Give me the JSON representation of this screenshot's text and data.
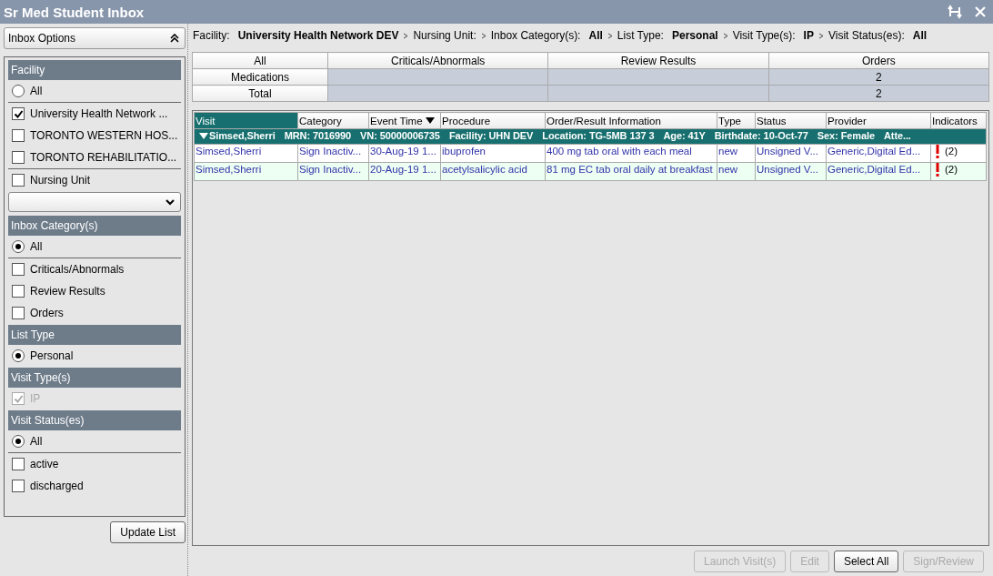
{
  "window": {
    "title": "Sr Med Student Inbox"
  },
  "sidebar": {
    "header": "Inbox Options",
    "sections": [
      {
        "title": "Facility",
        "items": [
          {
            "kind": "radio",
            "label": "All",
            "selected": false,
            "separated": true
          },
          {
            "kind": "checkbox",
            "label": "University Health Network ...",
            "checked": true,
            "disabled": false,
            "separated": false
          },
          {
            "kind": "checkbox",
            "label": "TORONTO WESTERN HOS...",
            "checked": false,
            "disabled": false,
            "separated": false
          },
          {
            "kind": "checkbox",
            "label": "TORONTO REHABILITATIO...",
            "checked": false,
            "disabled": false,
            "separated": true
          },
          {
            "kind": "checkbox",
            "label": "Nursing Unit",
            "checked": false,
            "disabled": false,
            "separated": false
          },
          {
            "kind": "select"
          }
        ]
      },
      {
        "title": "Inbox Category(s)",
        "items": [
          {
            "kind": "radio",
            "label": "All",
            "selected": true,
            "separated": true
          },
          {
            "kind": "checkbox",
            "label": "Criticals/Abnormals",
            "checked": false,
            "disabled": false,
            "separated": false
          },
          {
            "kind": "checkbox",
            "label": "Review Results",
            "checked": false,
            "disabled": false,
            "separated": false
          },
          {
            "kind": "checkbox",
            "label": "Orders",
            "checked": false,
            "disabled": false,
            "separated": false
          }
        ]
      },
      {
        "title": "List Type",
        "items": [
          {
            "kind": "radio",
            "label": "Personal",
            "selected": true,
            "separated": false
          }
        ]
      },
      {
        "title": "Visit Type(s)",
        "items": [
          {
            "kind": "checkbox",
            "label": "IP",
            "checked": true,
            "disabled": true,
            "separated": false
          }
        ]
      },
      {
        "title": "Visit Status(es)",
        "items": [
          {
            "kind": "radio",
            "label": "All",
            "selected": true,
            "separated": true
          },
          {
            "kind": "checkbox",
            "label": "active",
            "checked": false,
            "disabled": false,
            "separated": false
          },
          {
            "kind": "checkbox",
            "label": "discharged",
            "checked": false,
            "disabled": false,
            "separated": false
          }
        ]
      }
    ],
    "update_button": "Update List"
  },
  "breadcrumb": [
    {
      "label": "Facility:",
      "value": "University Health Network DEV"
    },
    {
      "label": "Nursing Unit:"
    },
    {
      "label": "Inbox Category(s):",
      "value": "All"
    },
    {
      "label": "List Type:",
      "value": "Personal"
    },
    {
      "label": "Visit Type(s):",
      "value": "IP"
    },
    {
      "label": "Visit Status(es):",
      "value": "All"
    }
  ],
  "summary": {
    "columns": [
      "All",
      "Criticals/Abnormals",
      "Review Results",
      "Orders"
    ],
    "rows": [
      {
        "label": "Medications",
        "cells": [
          "",
          "",
          "2"
        ]
      },
      {
        "label": "Total",
        "cells": [
          "",
          "",
          "2"
        ]
      }
    ]
  },
  "grid": {
    "columns": [
      {
        "label": "Visit",
        "selected": true,
        "sorted": false
      },
      {
        "label": "Category",
        "selected": false,
        "sorted": false
      },
      {
        "label": "Event Time",
        "selected": false,
        "sorted": true
      },
      {
        "label": "Procedure",
        "selected": false,
        "sorted": false
      },
      {
        "label": "Order/Result Information",
        "selected": false,
        "sorted": false
      },
      {
        "label": "Type",
        "selected": false,
        "sorted": false
      },
      {
        "label": "Status",
        "selected": false,
        "sorted": false
      },
      {
        "label": "Provider",
        "selected": false,
        "sorted": false
      },
      {
        "label": "Indicators",
        "selected": false,
        "sorted": false
      }
    ],
    "group": {
      "name": "Simsed,Sherri",
      "expanded": true,
      "details": [
        "MRN: 7016990",
        "VN: 50000006735",
        "Facility: UHN DEV",
        "Location: TG-5MB 137 3",
        "Age: 41Y",
        "Birthdate: 10-Oct-77",
        "Sex: Female",
        "Atte..."
      ]
    },
    "rows": [
      {
        "cells": [
          "Simsed,Sherri",
          "Sign Inactiv...",
          "30-Aug-19 1...",
          "ibuprofen",
          "400 mg tab oral with each meal",
          "new",
          "Unsigned V...",
          "Generic,Digital Ed..."
        ],
        "alert": true,
        "indicator": "(2)"
      },
      {
        "cells": [
          "Simsed,Sherri",
          "Sign Inactiv...",
          "20-Aug-19 1...",
          "acetylsalicylic acid",
          "81 mg EC tab oral daily at breakfast",
          "new",
          "Unsigned V...",
          "Generic,Digital Ed..."
        ],
        "alert": true,
        "indicator": "(2)"
      }
    ]
  },
  "buttons": [
    {
      "label": "Launch Visit(s)",
      "disabled": true
    },
    {
      "label": "Edit",
      "disabled": true
    },
    {
      "label": "Select All",
      "disabled": false
    },
    {
      "label": "Sign/Review",
      "disabled": true
    }
  ]
}
